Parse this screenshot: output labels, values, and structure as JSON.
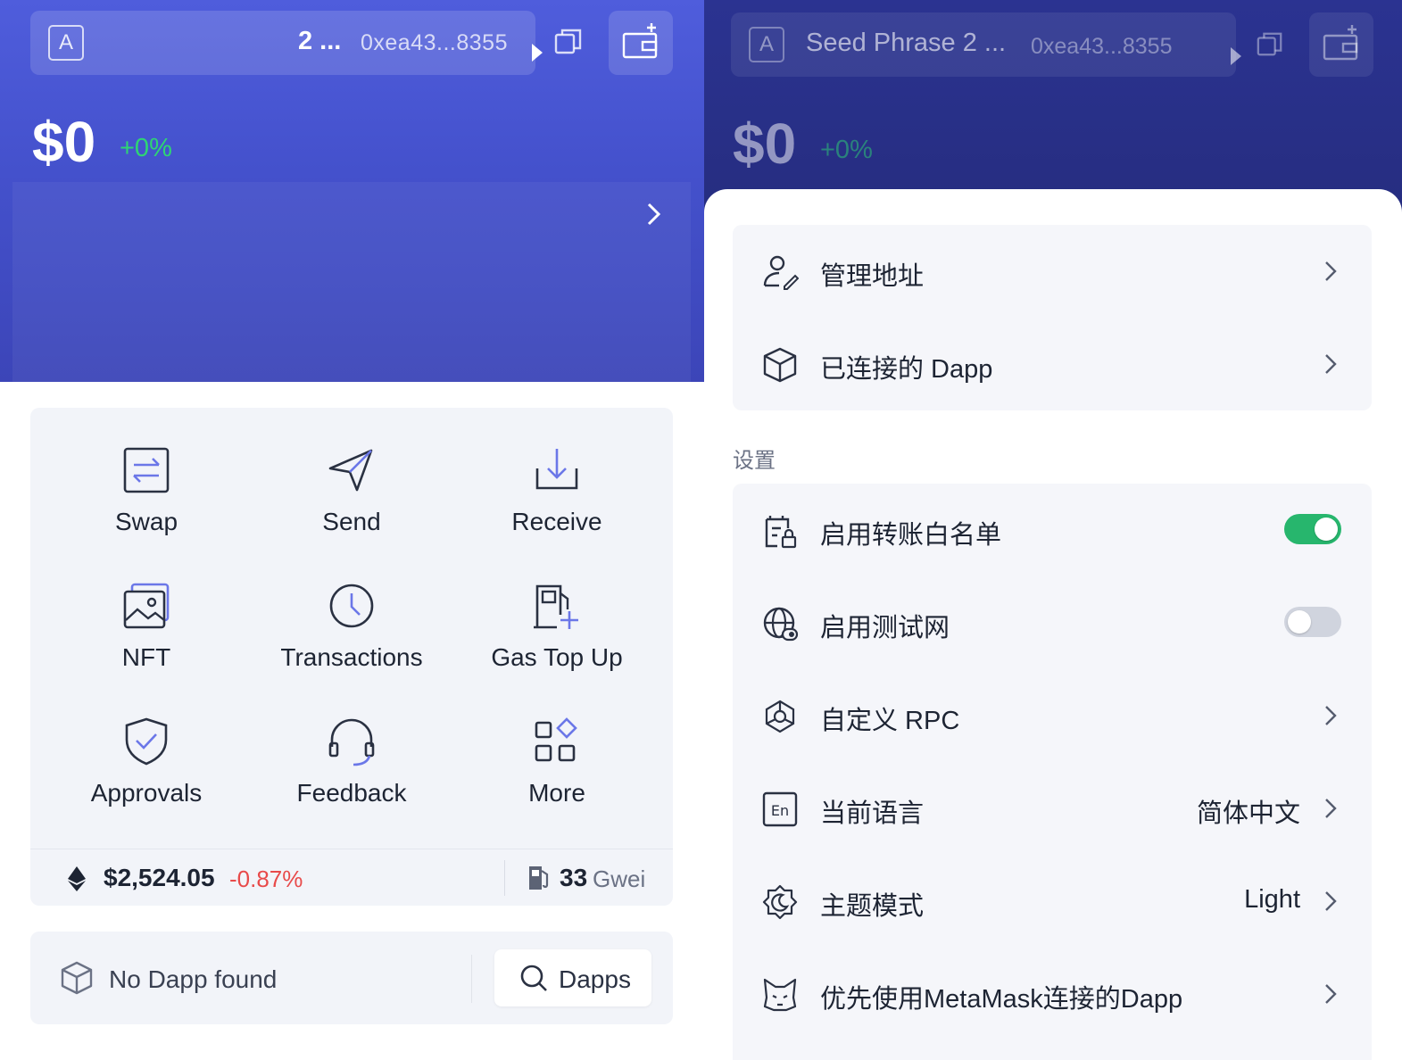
{
  "left": {
    "account": {
      "avatar_letter": "A",
      "name": "2 ...",
      "address": "0xea43...8355"
    },
    "balance": "$0",
    "change": "+0%",
    "actions": [
      {
        "label": "Swap",
        "icon": "swap-icon"
      },
      {
        "label": "Send",
        "icon": "send-icon"
      },
      {
        "label": "Receive",
        "icon": "receive-icon"
      },
      {
        "label": "NFT",
        "icon": "nft-icon"
      },
      {
        "label": "Transactions",
        "icon": "clock-icon"
      },
      {
        "label": "Gas Top Up",
        "icon": "gas-pump-icon"
      },
      {
        "label": "Approvals",
        "icon": "shield-check-icon"
      },
      {
        "label": "Feedback",
        "icon": "headset-icon"
      },
      {
        "label": "More",
        "icon": "grid-icon"
      }
    ],
    "eth": {
      "price": "$2,524.05",
      "change": "-0.87%"
    },
    "gas": {
      "value": "33",
      "unit": "Gwei"
    },
    "dapp": {
      "empty_text": "No Dapp found",
      "button_label": "Dapps"
    },
    "colors": {
      "hero": "#4a56d6",
      "positive": "#2ed573",
      "negative": "#e84a4a"
    }
  },
  "right": {
    "account": {
      "avatar_letter": "A",
      "name": "Seed Phrase 2 ...",
      "address": "0xea43...8355"
    },
    "balance": "$0",
    "change": "+0%",
    "group1": [
      {
        "label": "管理地址",
        "icon": "user-edit-icon"
      },
      {
        "label": "已连接的 Dapp",
        "icon": "cube-icon"
      }
    ],
    "settings_title": "设置",
    "settings": [
      {
        "label": "启用转账白名单",
        "icon": "whitelist-icon",
        "toggle": true
      },
      {
        "label": "启用测试网",
        "icon": "globe-icon",
        "toggle": false
      },
      {
        "label": "自定义 RPC",
        "icon": "rpc-icon"
      },
      {
        "label": "当前语言",
        "icon": "language-icon",
        "value": "简体中文"
      },
      {
        "label": "主题模式",
        "icon": "theme-icon",
        "value": "Light"
      },
      {
        "label": "优先使用MetaMask连接的Dapp",
        "icon": "metamask-icon"
      }
    ],
    "colors": {
      "toggle_on": "#27b66d",
      "toggle_off": "#d0d4de"
    }
  }
}
